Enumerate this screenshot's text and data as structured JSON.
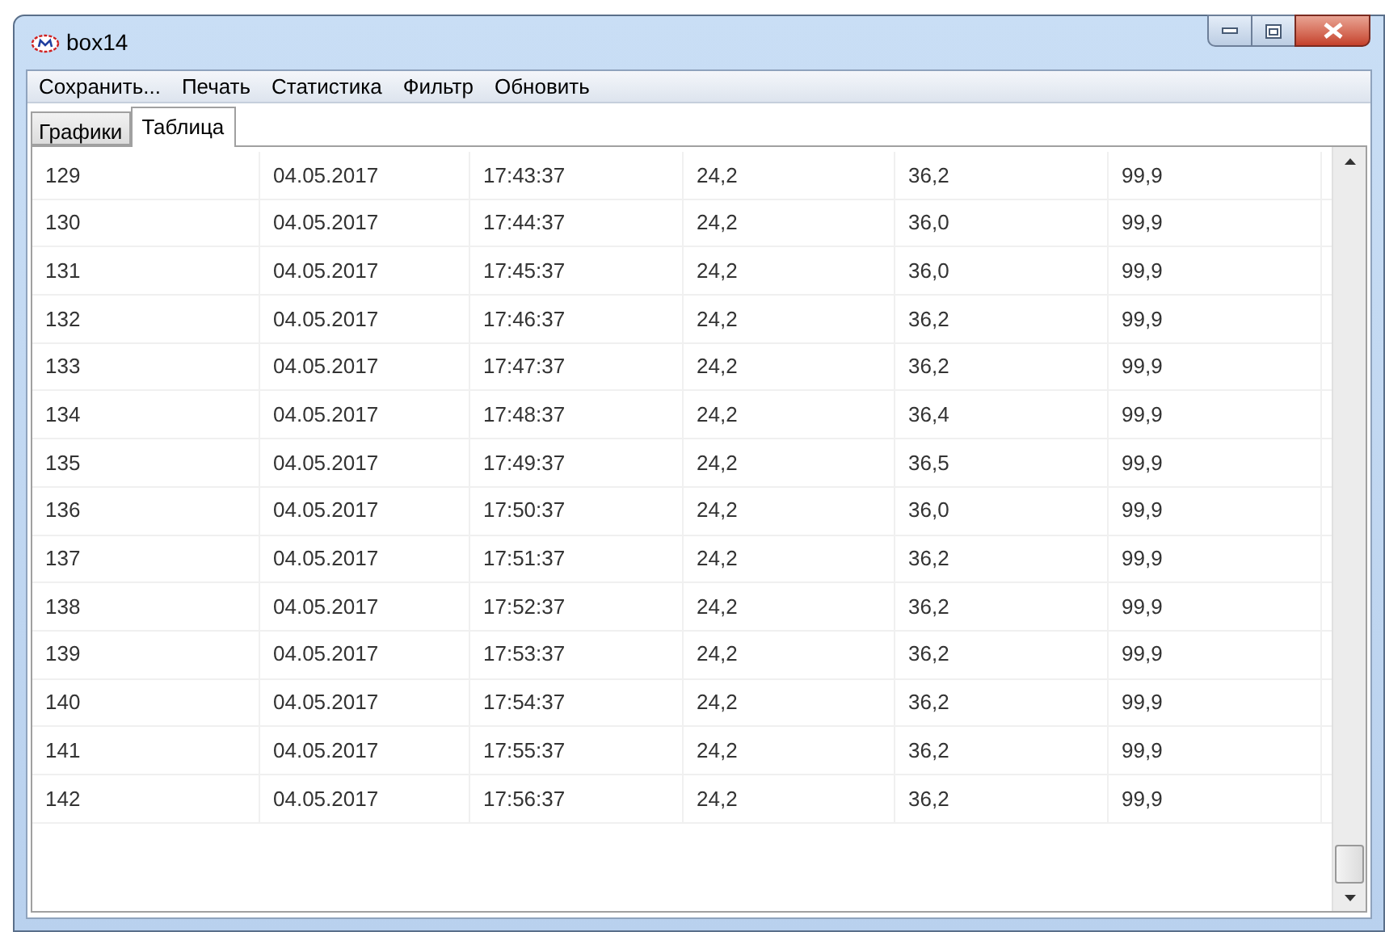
{
  "window": {
    "title": "box14"
  },
  "menu": [
    "Сохранить...",
    "Печать",
    "Статистика",
    "Фильтр",
    "Обновить"
  ],
  "tabs": [
    {
      "label": "Графики",
      "selected": false
    },
    {
      "label": "Таблица",
      "selected": true
    }
  ],
  "table": {
    "rows": [
      [
        "129",
        "04.05.2017",
        "17:43:37",
        "24,2",
        "36,2",
        "99,9"
      ],
      [
        "130",
        "04.05.2017",
        "17:44:37",
        "24,2",
        "36,0",
        "99,9"
      ],
      [
        "131",
        "04.05.2017",
        "17:45:37",
        "24,2",
        "36,0",
        "99,9"
      ],
      [
        "132",
        "04.05.2017",
        "17:46:37",
        "24,2",
        "36,2",
        "99,9"
      ],
      [
        "133",
        "04.05.2017",
        "17:47:37",
        "24,2",
        "36,2",
        "99,9"
      ],
      [
        "134",
        "04.05.2017",
        "17:48:37",
        "24,2",
        "36,4",
        "99,9"
      ],
      [
        "135",
        "04.05.2017",
        "17:49:37",
        "24,2",
        "36,5",
        "99,9"
      ],
      [
        "136",
        "04.05.2017",
        "17:50:37",
        "24,2",
        "36,0",
        "99,9"
      ],
      [
        "137",
        "04.05.2017",
        "17:51:37",
        "24,2",
        "36,2",
        "99,9"
      ],
      [
        "138",
        "04.05.2017",
        "17:52:37",
        "24,2",
        "36,2",
        "99,9"
      ],
      [
        "139",
        "04.05.2017",
        "17:53:37",
        "24,2",
        "36,2",
        "99,9"
      ],
      [
        "140",
        "04.05.2017",
        "17:54:37",
        "24,2",
        "36,2",
        "99,9"
      ],
      [
        "141",
        "04.05.2017",
        "17:55:37",
        "24,2",
        "36,2",
        "99,9"
      ],
      [
        "142",
        "04.05.2017",
        "17:56:37",
        "24,2",
        "36,2",
        "99,9"
      ]
    ]
  }
}
